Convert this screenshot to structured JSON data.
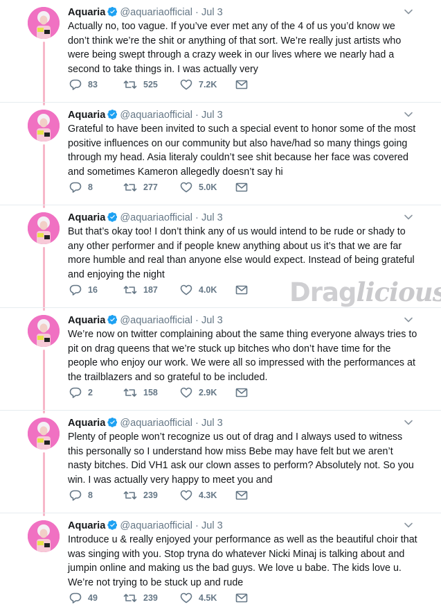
{
  "watermark": {
    "text_a": "Drag",
    "text_b": "licious"
  },
  "tweets": [
    {
      "name": "Aquaria",
      "handle": "@aquariaofficial",
      "separator": "·",
      "date": "Jul 3",
      "text": "Actually no, too vague. If you’ve ever met any of the 4 of us you’d know we don’t think we’re the shit or anything of that sort. We’re really just artists who were being swept through a crazy week in our lives where we nearly had a second to take things in. I was actually very",
      "replies": "83",
      "retweets": "525",
      "likes": "7.2K"
    },
    {
      "name": "Aquaria",
      "handle": "@aquariaofficial",
      "separator": "·",
      "date": "Jul 3",
      "text": "Grateful to have been invited to such a special event to honor some of the most positive influences on our community but also have/had so many things going through my head. Asia literaly couldn’t see shit because her face was covered and sometimes Kameron allegedly doesn’t say hi",
      "replies": "8",
      "retweets": "277",
      "likes": "5.0K"
    },
    {
      "name": "Aquaria",
      "handle": "@aquariaofficial",
      "separator": "·",
      "date": "Jul 3",
      "text": "But that’s okay too! I don’t think any of us would intend to be rude or shady to any other performer and if people knew anything about us it’s that we are far more humble and real than anyone else would expect. Instead of being grateful and enjoying the night",
      "replies": "16",
      "retweets": "187",
      "likes": "4.0K"
    },
    {
      "name": "Aquaria",
      "handle": "@aquariaofficial",
      "separator": "·",
      "date": "Jul 3",
      "text": "We’re now on twitter complaining about the same thing everyone always tries to pit on drag queens that we’re stuck up bitches who don’t have time for the people who enjoy our work. We were all so impressed with the performances at the trailblazers and so grateful to be included.",
      "replies": "2",
      "retweets": "158",
      "likes": "2.9K"
    },
    {
      "name": "Aquaria",
      "handle": "@aquariaofficial",
      "separator": "·",
      "date": "Jul 3",
      "text": "Plenty of people won’t recognize us out of drag and I always used to witness this personally so I understand how miss Bebe may have felt but we aren’t nasty bitches. Did VH1 ask our clown asses to perform? Absolutely not. So you win. I was actually very happy to meet you and",
      "replies": "8",
      "retweets": "239",
      "likes": "4.3K"
    },
    {
      "name": "Aquaria",
      "handle": "@aquariaofficial",
      "separator": "·",
      "date": "Jul 3",
      "text": "Introduce u & really enjoyed your performance as well as the beautiful choir that was singing with you. Stop tryna do whatever Nicki Minaj is talking about and jumpin online and making us the bad guys. We love u babe. The kids love u. We’re not trying to be stuck up and rude",
      "replies": "49",
      "retweets": "239",
      "likes": "4.5K"
    }
  ]
}
